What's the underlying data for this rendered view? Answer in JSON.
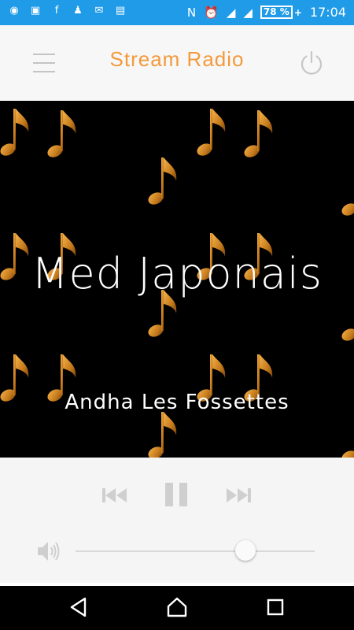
{
  "statusbar": {
    "left_icons": [
      "chat-icon",
      "photo-icon",
      "facebook-icon",
      "add-contact-icon",
      "messenger-icon",
      "gallery-icon"
    ],
    "battery": "78 %",
    "battery_plus": "+",
    "time": "17:04"
  },
  "appbar": {
    "title": "Stream Radio"
  },
  "now_playing": {
    "station": "Med Japonais",
    "song": "Andha Les Fossettes"
  },
  "player": {
    "volume_level": 0.71,
    "state": "playing"
  },
  "colors": {
    "status_bar": "#1f9be8",
    "accent": "#f39a3c",
    "note": "#c98a2a"
  }
}
